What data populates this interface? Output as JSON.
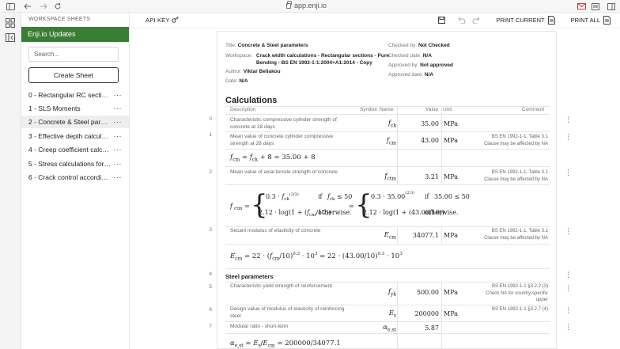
{
  "browser": {
    "url": "app.enji.io"
  },
  "sidebar": {
    "workspace_label": "WORKSPACE SHEETS",
    "workspace_name": "Enji.io Updates",
    "search_placeholder": "Search...",
    "create_label": "Create Sheet",
    "items": [
      {
        "label": "0 - Rectangular RC sections - Pure Bending",
        "active": false
      },
      {
        "label": "1 - SLS Moments",
        "active": false
      },
      {
        "label": "2 - Concrete & Steel parameters",
        "active": true
      },
      {
        "label": "3 - Effective depth calculation",
        "active": false
      },
      {
        "label": "4 - Creep coefficient calculation",
        "active": false
      },
      {
        "label": "5 - Stress calculations for SLS",
        "active": false
      },
      {
        "label": "6 - Crack control according to EC2",
        "active": false
      }
    ],
    "item_menu": "···"
  },
  "toolbar": {
    "api_key": "API KEY",
    "print_current": "PRINT CURRENT",
    "print_all": "PRINT ALL"
  },
  "meta": {
    "title_label": "Title:",
    "title_value": "Concrete & Steel parameters",
    "workspace_label": "Workspace:",
    "workspace_value_1": "Crack width calculations - Rectangular sections - Pure",
    "workspace_value_2": "Bending - BS EN 1992-1-1:2004+A1:2014 - Copy",
    "author_label": "Author:",
    "author_value": "Viktar Beliakou",
    "date_label": "Date:",
    "date_value": "N/A",
    "checked_by_label": "Checked by:",
    "checked_by_value": "Not Checked",
    "checked_date_label": "Checked date:",
    "checked_date_value": "N/A",
    "approved_by_label": "Approved by:",
    "approved_by_value": "Not approved",
    "approved_date_label": "Approved date:",
    "approved_date_value": "N/A"
  },
  "calc": {
    "heading": "Calculations",
    "col_description": "Description",
    "col_symbol": "Symbol",
    "col_name": "Name",
    "col_value": "Value",
    "col_unit": "Unit",
    "col_comment": "Comment",
    "rows": [
      {
        "num": "0",
        "desc_1": "Characteristic compressive cylinder strength of",
        "desc_2": "concrete at 28 days",
        "value": "35.00",
        "unit": "MPa",
        "note_1": "",
        "note_2": "",
        "note_3": ""
      },
      {
        "num": "1",
        "desc_1": "Mean value of concrete cylinder compressive",
        "desc_2": "strength at 28 days",
        "value": "43.00",
        "unit": "MPa",
        "note_1": "BS EN 1992-1-1, Table 3.1",
        "note_2": "Clause may be affected by NA",
        "note_3": ""
      },
      {
        "num": "2",
        "desc_1": "Mean value of axial tensile strength of concrete",
        "desc_2": "",
        "value": "3.21",
        "unit": "MPa",
        "note_1": "BS EN 1992-1-1, Table 3.1",
        "note_2": "Clause may be affected by NA",
        "note_3": ""
      },
      {
        "num": "3",
        "desc_1": "Secant modulus of elasticity of concrete",
        "desc_2": "",
        "value": "34077.1",
        "unit": "MPa",
        "note_1": "BS EN 1992-1-1, Table 3.1",
        "note_2": "Clause may be affected by NA",
        "note_3": ""
      },
      {
        "num": "4",
        "desc_1": "",
        "desc_2": "",
        "value": "",
        "unit": "",
        "note_1": "",
        "note_2": "",
        "note_3": ""
      },
      {
        "num": "5",
        "desc_1": "Characteristic yield strength of reinforcement",
        "desc_2": "",
        "value": "500.00",
        "unit": "MPa",
        "note_1": "BS EN 1992-1-1 §3.2.2 (3)",
        "note_2": "Check NA for country-specific",
        "note_3": "upper"
      },
      {
        "num": "6",
        "desc_1": "Design value of modulus of elasticity of reinforcing",
        "desc_2": "steel",
        "value": "200000",
        "unit": "MPa",
        "note_1": "BS EN 1992-1-1 §3.2.7 (4)",
        "note_2": "",
        "note_3": ""
      },
      {
        "num": "7",
        "desc_1": "Modular ratio - short-term",
        "desc_2": "",
        "value": "5.87",
        "unit": "",
        "note_1": "",
        "note_2": "",
        "note_3": ""
      }
    ],
    "section_steel": "Steel parameters",
    "formula_if": "if",
    "formula_otherwise": "otherwise."
  }
}
